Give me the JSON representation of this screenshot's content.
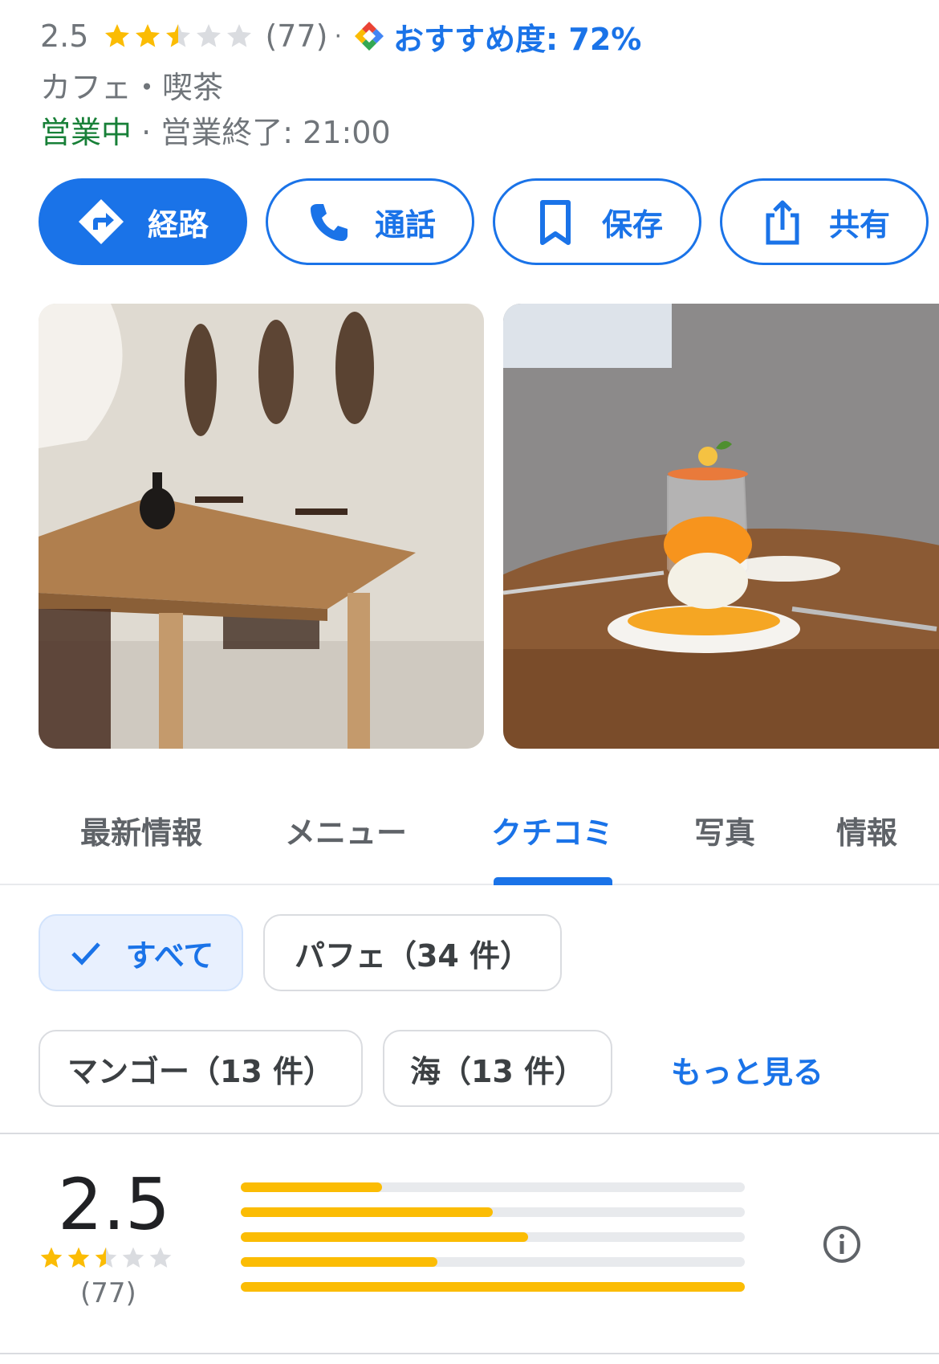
{
  "header": {
    "rating": "2.5",
    "rating_stars": 2.5,
    "review_count": "(77)",
    "separator": "·",
    "recommend": "おすすめ度: 72%",
    "category": "カフェ・喫茶",
    "open_status": "営業中",
    "status_separator": " · ",
    "closing_time": "営業終了: 21:00"
  },
  "actions": {
    "directions": "経路",
    "call": "通話",
    "save": "保存",
    "share": "共有"
  },
  "photos": [
    {
      "icon": "cafe-interior-photo"
    },
    {
      "icon": "mango-parfait-photo"
    }
  ],
  "tabs": [
    {
      "label": "最新情報",
      "active": false
    },
    {
      "label": "メニュー",
      "active": false
    },
    {
      "label": "クチコミ",
      "active": true
    },
    {
      "label": "写真",
      "active": false
    },
    {
      "label": "情報",
      "active": false
    }
  ],
  "chips": {
    "all": "すべて",
    "parfait": "パフェ（34 件）",
    "mango": "マンゴー（13 件）",
    "sea": "海（13 件）",
    "more": "もっと見る"
  },
  "summary": {
    "rating": "2.5",
    "stars": 2.5,
    "count": "(77)",
    "distribution": [
      0.28,
      0.5,
      0.57,
      0.39,
      1.0
    ]
  },
  "colors": {
    "accent": "#1a73e8",
    "star": "#fbbc04",
    "open": "#188038"
  }
}
